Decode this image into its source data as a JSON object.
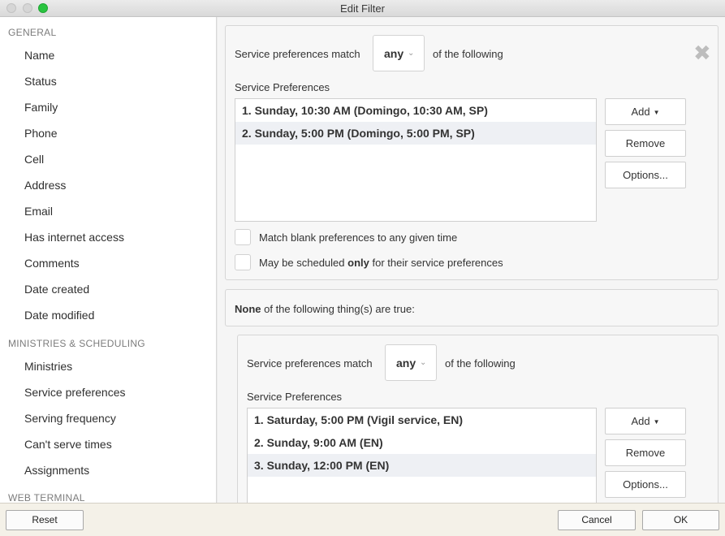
{
  "window": {
    "title": "Edit Filter"
  },
  "sidebar": {
    "sections": [
      {
        "heading": "GENERAL",
        "items": [
          "Name",
          "Status",
          "Family",
          "Phone",
          "Cell",
          "Address",
          "Email",
          "Has internet access",
          "Comments",
          "Date created",
          "Date modified"
        ]
      },
      {
        "heading": "MINISTRIES & SCHEDULING",
        "items": [
          "Ministries",
          "Service preferences",
          "Serving frequency",
          "Can't serve times",
          "Assignments"
        ]
      },
      {
        "heading": "WEB TERMINAL",
        "items": []
      }
    ]
  },
  "filter1": {
    "match_prefix": "Service preferences match",
    "match_value": "any",
    "match_suffix": "of the following",
    "list_label": "Service Preferences",
    "items": [
      "1. Sunday, 10:30 AM (Domingo, 10:30 AM, SP)",
      "2. Sunday, 5:00 PM (Domingo, 5:00 PM, SP)"
    ],
    "add_label": "Add",
    "remove_label": "Remove",
    "options_label": "Options...",
    "checkbox1_label": "Match blank preferences to any given time",
    "checkbox2_before": "May be scheduled ",
    "checkbox2_bold": "only",
    "checkbox2_after": " for their service preferences",
    "close_symbol": "✖"
  },
  "none_group": {
    "bold": "None",
    "rest": " of the following thing(s) are true:"
  },
  "filter2": {
    "match_prefix": "Service preferences match",
    "match_value": "any",
    "match_suffix": "of the following",
    "list_label": "Service Preferences",
    "items": [
      "1. Saturday, 5:00 PM (Vigil service, EN)",
      "2. Sunday, 9:00 AM (EN)",
      "3. Sunday, 12:00 PM (EN)"
    ],
    "add_label": "Add",
    "remove_label": "Remove",
    "options_label": "Options..."
  },
  "footer": {
    "reset_label": "Reset",
    "cancel_label": "Cancel",
    "ok_label": "OK"
  }
}
